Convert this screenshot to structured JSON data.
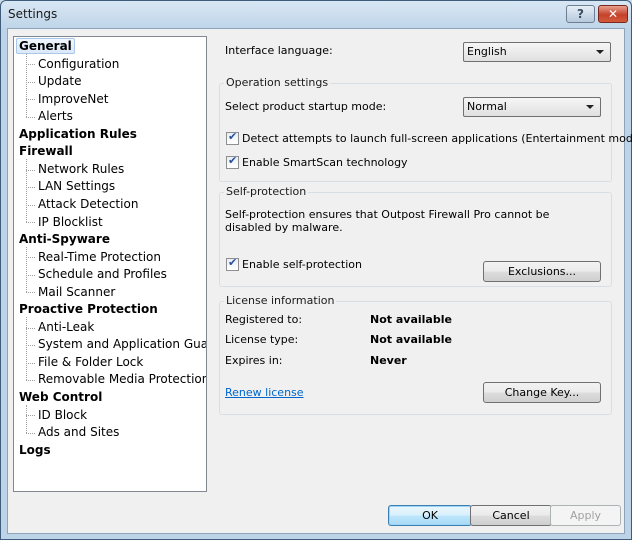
{
  "window": {
    "title": "Settings",
    "help_label": "?",
    "close_label": "✕"
  },
  "tree": {
    "items": [
      {
        "label": "General",
        "level": 0,
        "selected": true
      },
      {
        "label": "Configuration",
        "level": 1
      },
      {
        "label": "Update",
        "level": 1
      },
      {
        "label": "ImproveNet",
        "level": 1
      },
      {
        "label": "Alerts",
        "level": 1
      },
      {
        "label": "Application Rules",
        "level": 0
      },
      {
        "label": "Firewall",
        "level": 0
      },
      {
        "label": "Network Rules",
        "level": 1
      },
      {
        "label": "LAN Settings",
        "level": 1
      },
      {
        "label": "Attack Detection",
        "level": 1
      },
      {
        "label": "IP Blocklist",
        "level": 1
      },
      {
        "label": "Anti-Spyware",
        "level": 0
      },
      {
        "label": "Real-Time Protection",
        "level": 1
      },
      {
        "label": "Schedule and Profiles",
        "level": 1
      },
      {
        "label": "Mail Scanner",
        "level": 1
      },
      {
        "label": "Proactive Protection",
        "level": 0
      },
      {
        "label": "Anti-Leak",
        "level": 1
      },
      {
        "label": "System and Application Guard",
        "level": 1
      },
      {
        "label": "File & Folder Lock",
        "level": 1
      },
      {
        "label": "Removable Media Protection",
        "level": 1
      },
      {
        "label": "Web Control",
        "level": 0
      },
      {
        "label": "ID Block",
        "level": 1
      },
      {
        "label": "Ads and Sites",
        "level": 1
      },
      {
        "label": "Logs",
        "level": 0
      }
    ]
  },
  "general": {
    "interface_language_label": "Interface language:",
    "interface_language_value": "English",
    "operation": {
      "title": "Operation settings",
      "startup_mode_label": "Select product startup mode:",
      "startup_mode_value": "Normal",
      "entertainment_label": "Detect attempts to launch full-screen applications (Entertainment mode)",
      "entertainment_checked": true,
      "smartscan_label": "Enable SmartScan technology",
      "smartscan_checked": true
    },
    "self_protection": {
      "title": "Self-protection",
      "description": "Self-protection ensures that Outpost Firewall Pro cannot be disabled by malware.",
      "enable_label": "Enable self-protection",
      "enable_checked": true,
      "exclusions_button": "Exclusions..."
    },
    "license": {
      "title": "License information",
      "registered_label": "Registered to:",
      "registered_value": "Not available",
      "type_label": "License type:",
      "type_value": "Not available",
      "expires_label": "Expires in:",
      "expires_value": "Never",
      "renew_link": "Renew license",
      "change_key_button": "Change Key..."
    }
  },
  "footer": {
    "ok": "OK",
    "cancel": "Cancel",
    "apply": "Apply"
  },
  "check_glyph": "✔"
}
